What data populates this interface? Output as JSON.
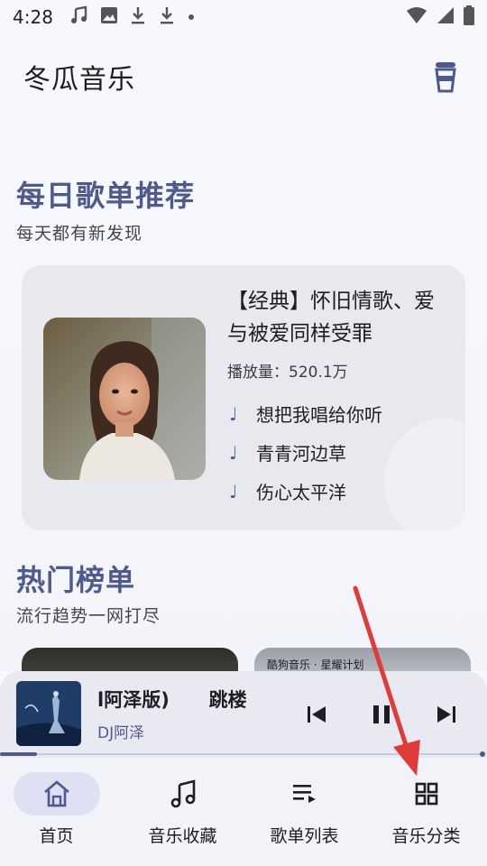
{
  "status_bar": {
    "time": "4:28",
    "icons": [
      "music-note-icon",
      "image-icon",
      "download-icon",
      "download-icon",
      "dot-icon"
    ],
    "right_icons": [
      "wifi-icon",
      "signal-icon",
      "battery-icon"
    ]
  },
  "app_bar": {
    "title": "冬瓜音乐",
    "action_icon": "cup-icon"
  },
  "daily": {
    "title": "每日歌单推荐",
    "subtitle": "每天都有新发现",
    "card": {
      "title": "【经典】怀旧情歌、爱与被爱同样受罪",
      "plays": "播放量：520.1万",
      "songs": [
        "想把我唱给你听",
        "青青河边草",
        "伤心太平洋"
      ]
    }
  },
  "charts": {
    "title": "热门榜单",
    "subtitle": "流行趋势一网打尽",
    "second_label": "酷狗音乐 · 星耀计划"
  },
  "player": {
    "title": "l阿泽版)      跳楼",
    "artist": "DJ阿泽",
    "progress": 0.075
  },
  "nav": {
    "items": [
      {
        "label": "首页",
        "icon": "home-icon",
        "active": true
      },
      {
        "label": "音乐收藏",
        "icon": "music-collection-icon",
        "active": false
      },
      {
        "label": "歌单列表",
        "icon": "playlist-icon",
        "active": false
      },
      {
        "label": "音乐分类",
        "icon": "category-grid-icon",
        "active": false
      }
    ]
  },
  "colors": {
    "accent": "#4e5a8c",
    "annotation_arrow": "#e03a3a"
  }
}
